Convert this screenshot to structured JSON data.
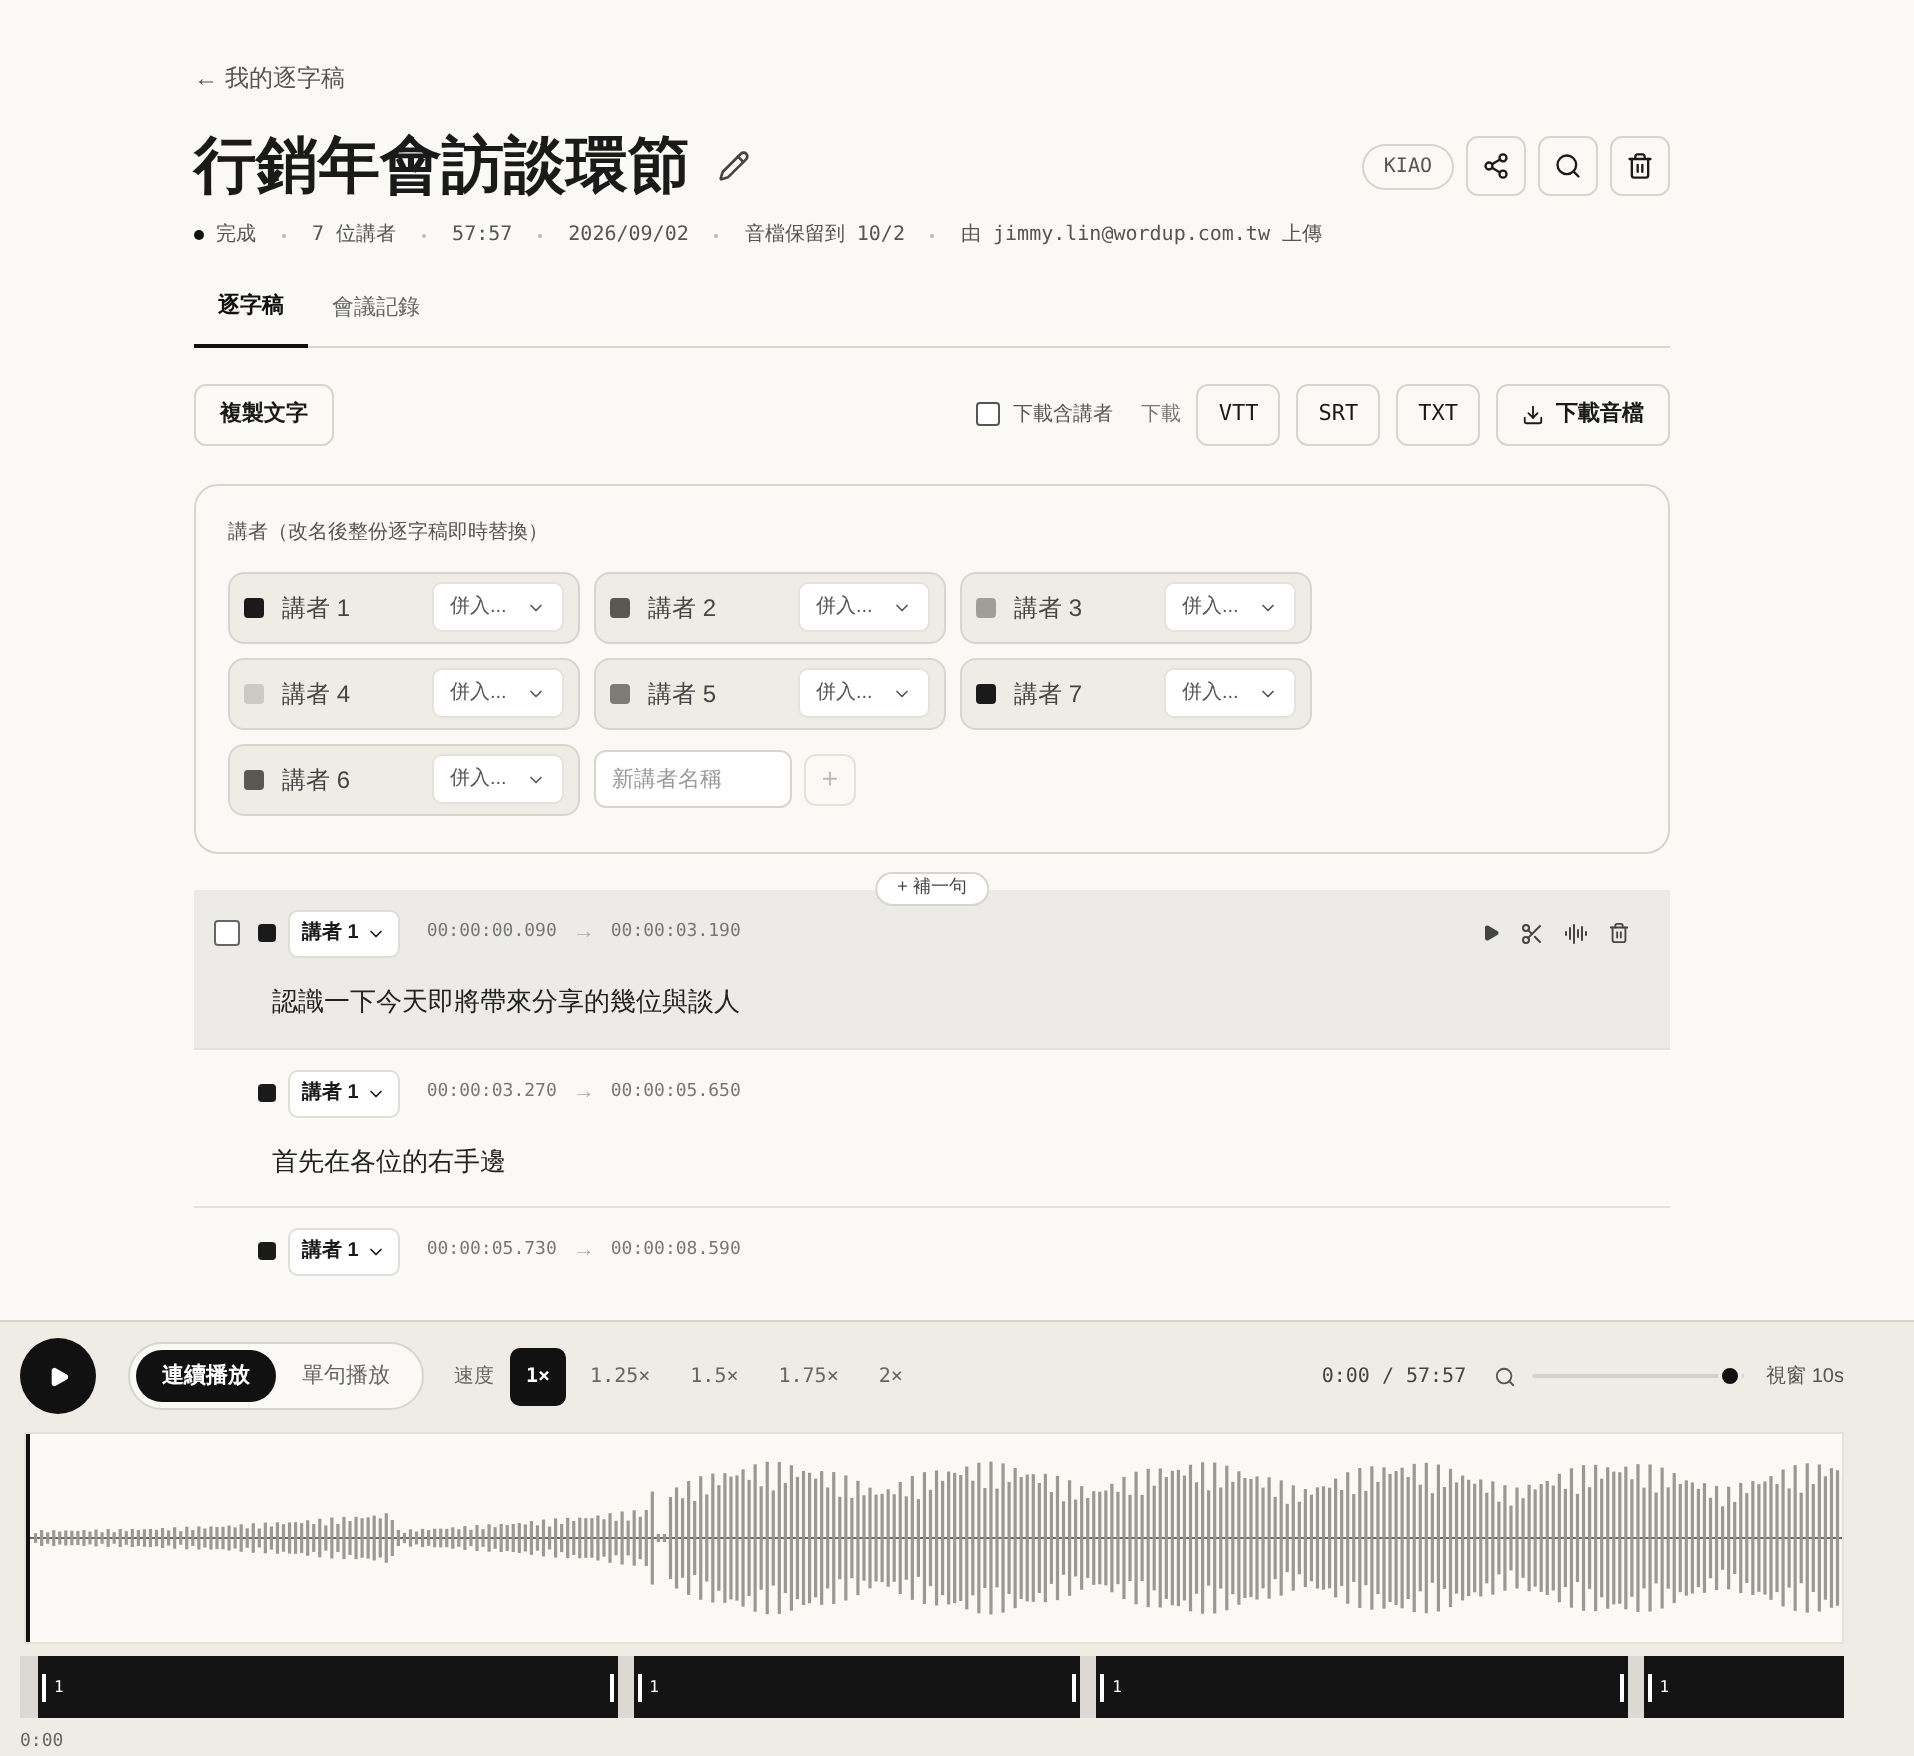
{
  "back_link": "← 我的逐字稿",
  "title": "行銷年會訪談環節",
  "owner_badge": "KIAO",
  "meta": [
    {
      "kind": "status",
      "text": "完成"
    },
    {
      "kind": "text",
      "text": "7 位講者"
    },
    {
      "kind": "text",
      "text": "57:57"
    },
    {
      "kind": "text",
      "text": "2026/09/02"
    },
    {
      "kind": "text",
      "text": "音檔保留到 10/2"
    },
    {
      "kind": "text",
      "text": "由 jimmy.lin@wordup.com.tw 上傳"
    }
  ],
  "tabs": [
    {
      "label": "逐字稿",
      "selected": true
    },
    {
      "label": "會議記錄",
      "selected": false
    }
  ],
  "toolbar": {
    "copy_button": "複製文字",
    "include_speakers": {
      "label": "下載含講者",
      "checked": false
    },
    "download_label": "下載",
    "formats": [
      "VTT",
      "SRT",
      "TXT"
    ],
    "download_audio": "下載音檔"
  },
  "speakers_panel": {
    "heading": "講者（改名後整份逐字稿即時替換）",
    "speakers": [
      {
        "name": "講者 1",
        "color": "#1a1a1a",
        "merge": "併入..."
      },
      {
        "name": "講者 2",
        "color": "#5a5852",
        "merge": "併入..."
      },
      {
        "name": "講者 3",
        "color": "#a19e98",
        "merge": "併入..."
      },
      {
        "name": "講者 4",
        "color": "#ccc9c3",
        "merge": "併入..."
      },
      {
        "name": "講者 5",
        "color": "#7e7b75",
        "merge": "併入..."
      },
      {
        "name": "講者 7",
        "color": "#1a1a1a",
        "merge": "併入..."
      },
      {
        "name": "講者 6",
        "color": "#5a5852",
        "merge": "併入..."
      }
    ],
    "new_speaker_placeholder": "新講者名稱",
    "add_button": "+"
  },
  "insert_button": "+ 補一句",
  "segments": [
    {
      "speaker": "講者 1",
      "color": "#1a1a1a",
      "start": "00:00:00.090",
      "end": "00:00:03.190",
      "arrow": "→",
      "text": "認識一下今天即將帶來分享的幾位與談人",
      "selected": true,
      "checked": false
    },
    {
      "speaker": "講者 1",
      "color": "#1a1a1a",
      "start": "00:00:03.270",
      "end": "00:00:05.650",
      "arrow": "→",
      "text": "首先在各位的右手邊",
      "selected": false
    },
    {
      "speaker": "講者 1",
      "color": "#1a1a1a",
      "start": "00:00:05.730",
      "end": "00:00:08.590",
      "arrow": "→",
      "selected": false
    }
  ],
  "player": {
    "modes": [
      {
        "label": "連續播放",
        "selected": true
      },
      {
        "label": "單句播放",
        "selected": false
      }
    ],
    "speed_label": "速度",
    "speeds": [
      {
        "label": "1×",
        "selected": true
      },
      {
        "label": "1.25×",
        "selected": false
      },
      {
        "label": "1.5×",
        "selected": false
      },
      {
        "label": "1.75×",
        "selected": false
      },
      {
        "label": "2×",
        "selected": false
      }
    ],
    "time": "0:00 / 57:57",
    "zoom": {
      "level": 0.93
    },
    "window_label": "視窗 10s",
    "timeline_segments": [
      {
        "label": "1"
      },
      {
        "label": "1"
      },
      {
        "label": "1"
      },
      {
        "label": "1"
      }
    ],
    "timeline_start": "0:00"
  }
}
